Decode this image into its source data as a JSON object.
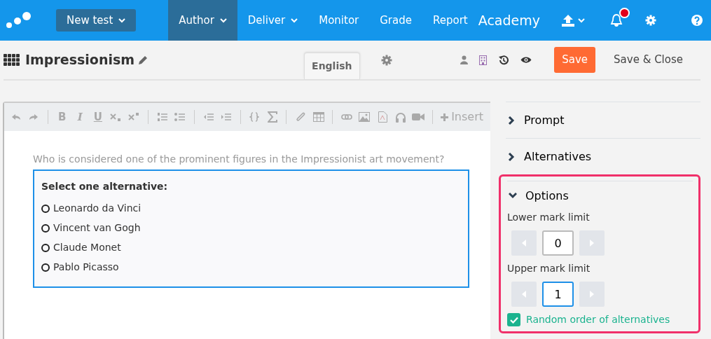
{
  "navbar": {
    "new_button": "New test",
    "items": [
      {
        "label": "Author",
        "selected": true,
        "dropdown": true
      },
      {
        "label": "Deliver",
        "selected": false,
        "dropdown": true
      },
      {
        "label": "Monitor",
        "selected": false,
        "dropdown": false
      },
      {
        "label": "Grade",
        "selected": false,
        "dropdown": false
      },
      {
        "label": "Report",
        "selected": false,
        "dropdown": false
      }
    ],
    "brand": "Academy",
    "notification_dot": true
  },
  "header": {
    "title": "Impressionism",
    "tabs": [
      {
        "label": "English",
        "selected": true
      }
    ],
    "save": "Save",
    "save_close": "Save & Close"
  },
  "toolbar": {
    "text_buttons": [
      "B",
      "I",
      "U"
    ],
    "insert": "Insert"
  },
  "question": {
    "prompt": "Who is considered one of the prominent figures in the Impressionist art movement?",
    "instruction": "Select one alternative:",
    "alternatives": [
      {
        "label": "Leonardo da Vinci",
        "selected": false
      },
      {
        "label": "Vincent van Gogh",
        "selected": false
      },
      {
        "label": "Claude Monet",
        "selected": false
      },
      {
        "label": "Pablo Picasso",
        "selected": false
      }
    ]
  },
  "panel": {
    "sections": [
      {
        "label": "Prompt",
        "expanded": false
      },
      {
        "label": "Alternatives",
        "expanded": false
      },
      {
        "label": "Options",
        "expanded": true
      }
    ],
    "lower_label": "Lower mark limit",
    "lower_value": "0",
    "upper_label": "Upper mark limit",
    "upper_value": "1",
    "upper_focused": true,
    "random_label": "Random order of alternatives",
    "random_checked": true
  }
}
